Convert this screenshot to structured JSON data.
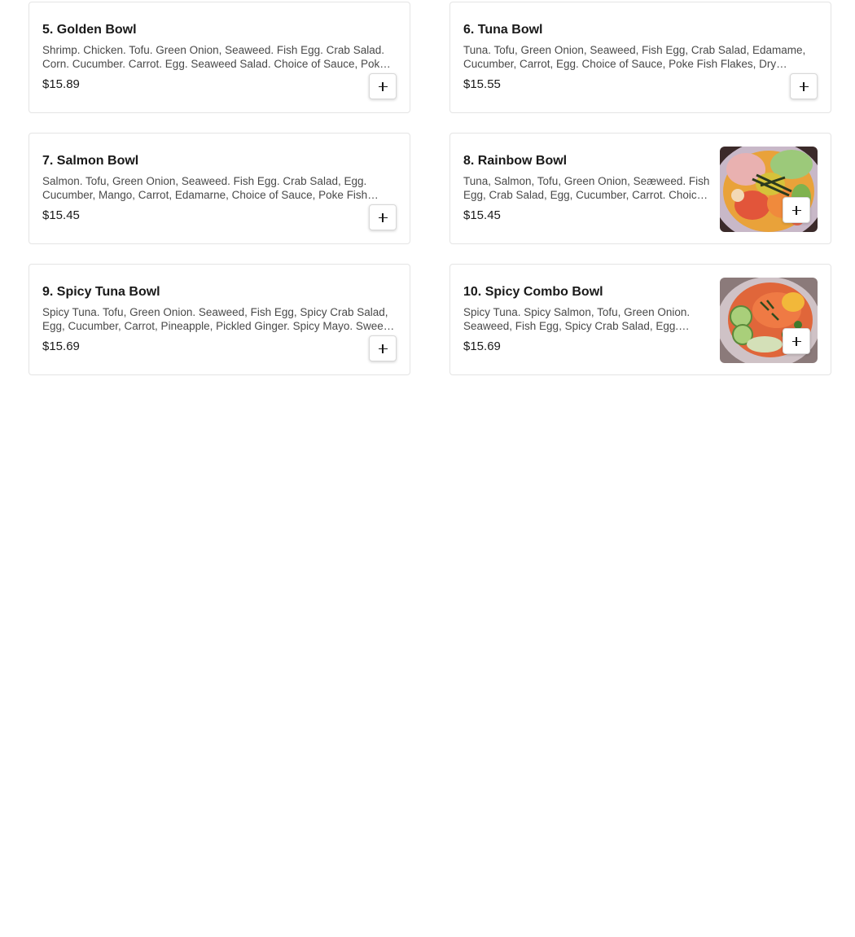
{
  "menu": {
    "items": [
      {
        "name": "5. Golden Bowl",
        "description": "Shrimp. Chicken. Tofu. Green Onion, Seaweed. Fish Egg. Crab Salad. Corn. Cucumber. Carrot. Egg. Seaweed Salad. Choice of Sauce, Poke Fish Flakes",
        "price": "$15.89",
        "has_image": false,
        "add_icon": "plus-icon"
      },
      {
        "name": "6. Tuna Bowl",
        "description": "Tuna. Tofu, Green Onion, Seaweed, Fish Egg, Crab Salad, Edamame, Cucumber, Carrot, Egg. Choice of Sauce, Poke Fish Flakes, Dry Seaweed",
        "price": "$15.55",
        "has_image": false,
        "add_icon": "plus-icon"
      },
      {
        "name": "7. Salmon Bowl",
        "description": "Salmon. Tofu, Green Onion, Seaweed. Fish Egg. Crab Salad, Egg. Cucumber, Mango, Carrot, Edamarne, Choice of Sauce, Poke Fish Flakes",
        "price": "$15.45",
        "has_image": false,
        "add_icon": "plus-icon"
      },
      {
        "name": "8. Rainbow Bowl",
        "description": "Tuna, Salmon, Tofu, Green Onion, Seæweed. Fish Egg, Crab Salad, Egg, Cucumber, Carrot. Choice of Sauce",
        "price": "$15.45",
        "has_image": true,
        "image_icon": "poke-bowl-photo",
        "add_icon": "plus-icon"
      },
      {
        "name": "9. Spicy Tuna Bowl",
        "description": "Spicy Tuna. Tofu, Green Onion. Seaweed, Fish Egg, Spicy Crab Salad, Egg, Cucumber, Carrot, Pineapple, Pickled Ginger. Spicy Mayo. Sweet Sauce",
        "price": "$15.69",
        "has_image": false,
        "add_icon": "plus-icon"
      },
      {
        "name": "10. Spicy Combo Bowl",
        "description": "Spicy Tuna. Spicy Salmon, Tofu, Green Onion. Seaweed, Fish Egg, Spicy Crab Salad, Egg. Cucumber, Carrot",
        "price": "$15.69",
        "has_image": true,
        "image_icon": "poke-bowl-photo",
        "add_icon": "plus-icon"
      }
    ]
  }
}
